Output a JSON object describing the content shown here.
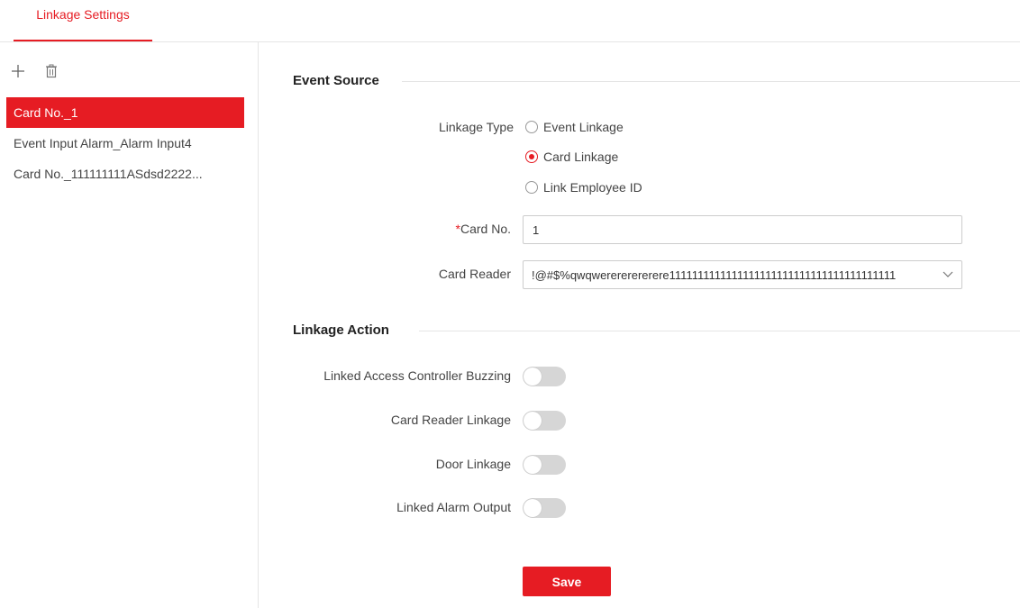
{
  "tabs": [
    {
      "label": "Linkage Settings",
      "active": true
    }
  ],
  "sidebar": {
    "toolbar": {
      "add_icon": "plus-icon",
      "delete_icon": "trash-icon"
    },
    "items": [
      {
        "label": "Card No._1",
        "selected": true
      },
      {
        "label": "Event Input Alarm_Alarm Input4",
        "selected": false
      },
      {
        "label": "Card No._111111111ASdsd2222...",
        "selected": false
      }
    ]
  },
  "event_source": {
    "title": "Event Source",
    "linkage_type": {
      "label": "Linkage Type",
      "options": [
        "Event Linkage",
        "Card Linkage",
        "Link Employee ID"
      ],
      "selected": "Card Linkage"
    },
    "card_no": {
      "required_mark": "*",
      "label": "Card No.",
      "value": "1"
    },
    "card_reader": {
      "label": "Card Reader",
      "value": "!@#$%qwqwerererererere1111111111111111111111111111111111111111"
    }
  },
  "linkage_action": {
    "title": "Linkage Action",
    "toggles": [
      {
        "label": "Linked Access Controller Buzzing",
        "on": false
      },
      {
        "label": "Card Reader Linkage",
        "on": false
      },
      {
        "label": "Door Linkage",
        "on": false
      },
      {
        "label": "Linked Alarm Output",
        "on": false
      }
    ]
  },
  "save_label": "Save",
  "colors": {
    "accent": "#e61c23",
    "toggle_off": "#d6d6d6",
    "divider": "#e5e5e5"
  }
}
